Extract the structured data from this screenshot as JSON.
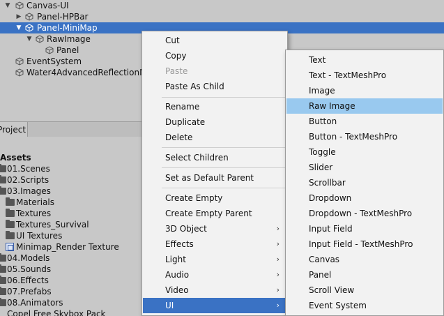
{
  "hierarchy": {
    "items": [
      {
        "label": "Canvas-UI",
        "foldout": "▼"
      },
      {
        "label": "Panel-HPBar",
        "foldout": "▶"
      },
      {
        "label": "Panel-MiniMap",
        "foldout": "▼",
        "selected": true
      },
      {
        "label": "RawImage",
        "foldout": "▼"
      },
      {
        "label": "Panel",
        "foldout": ""
      },
      {
        "label": "EventSystem",
        "foldout": ""
      },
      {
        "label": "Water4AdvancedReflectionM",
        "foldout": ""
      }
    ]
  },
  "project": {
    "tab_label": "Project",
    "tree": [
      {
        "label": "Assets"
      },
      {
        "label": "01.Scenes"
      },
      {
        "label": "02.Scripts"
      },
      {
        "label": "03.Images"
      },
      {
        "label": "Materials"
      },
      {
        "label": "Textures"
      },
      {
        "label": "Textures_Survival"
      },
      {
        "label": "UI Textures"
      },
      {
        "label": "Minimap_Render Texture"
      },
      {
        "label": "04.Models"
      },
      {
        "label": "05.Sounds"
      },
      {
        "label": "06.Effects"
      },
      {
        "label": "07.Prefabs"
      },
      {
        "label": "08.Animators"
      },
      {
        "label": "Copel Free Skybox Pack"
      }
    ]
  },
  "context_menu": {
    "items": [
      {
        "label": "Cut"
      },
      {
        "label": "Copy"
      },
      {
        "label": "Paste",
        "disabled": true
      },
      {
        "label": "Paste As Child"
      },
      {
        "label": "Rename"
      },
      {
        "label": "Duplicate"
      },
      {
        "label": "Delete"
      },
      {
        "label": "Select Children"
      },
      {
        "label": "Set as Default Parent"
      },
      {
        "label": "Create Empty"
      },
      {
        "label": "Create Empty Parent"
      },
      {
        "label": "3D Object",
        "submenu": true
      },
      {
        "label": "Effects",
        "submenu": true
      },
      {
        "label": "Light",
        "submenu": true
      },
      {
        "label": "Audio",
        "submenu": true
      },
      {
        "label": "Video",
        "submenu": true
      },
      {
        "label": "UI",
        "submenu": true,
        "active": true
      }
    ],
    "submenu_arrow": "›"
  },
  "ui_submenu": {
    "items": [
      {
        "label": "Text"
      },
      {
        "label": "Text - TextMeshPro"
      },
      {
        "label": "Image"
      },
      {
        "label": "Raw Image",
        "hover": true
      },
      {
        "label": "Button"
      },
      {
        "label": "Button - TextMeshPro"
      },
      {
        "label": "Toggle"
      },
      {
        "label": "Slider"
      },
      {
        "label": "Scrollbar"
      },
      {
        "label": "Dropdown"
      },
      {
        "label": "Dropdown - TextMeshPro"
      },
      {
        "label": "Input Field"
      },
      {
        "label": "Input Field - TextMeshPro"
      },
      {
        "label": "Canvas"
      },
      {
        "label": "Panel"
      },
      {
        "label": "Scroll View"
      },
      {
        "label": "Event System"
      }
    ]
  },
  "colors": {
    "selection": "#3a72c4",
    "hover": "#99c9ef",
    "panel_bg": "#c8c8c8",
    "menu_bg": "#f2f2f2"
  }
}
